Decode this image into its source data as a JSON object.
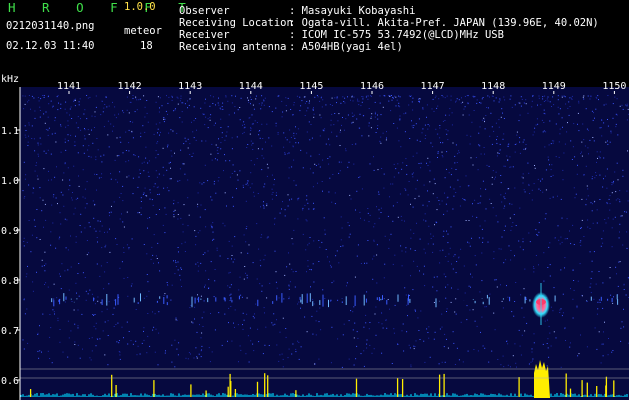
{
  "header": {
    "app_name": "H R O F F T",
    "version": "1.0.0",
    "filename": "0212031140.png",
    "datetime": "02.12.03 11:40",
    "meteor_label": "meteor",
    "meteor_count": "18",
    "info": [
      {
        "label": "Observer",
        "value": ": Masayuki Kobayashi"
      },
      {
        "label": "Receiving Location",
        "value": ": Ogata-vill. Akita-Pref. JAPAN (139.96E, 40.02N)"
      },
      {
        "label": "Receiver",
        "value": ": ICOM IC-575 53.7492(@LCD)MHz USB"
      },
      {
        "label": "Receiving antenna",
        "value": ": A504HB(yagi 4el)"
      }
    ]
  },
  "spectrogram": {
    "unit_label": "kHz",
    "y_ticks": [
      {
        "label": "1.1",
        "value": 1.1
      },
      {
        "label": "1.0",
        "value": 1.0
      },
      {
        "label": "0.9",
        "value": 0.9
      },
      {
        "label": "0.8",
        "value": 0.8
      },
      {
        "label": "0.7",
        "value": 0.7
      },
      {
        "label": "0.6",
        "value": 0.6
      }
    ],
    "x_ticks": [
      "1141",
      "1142",
      "1143",
      "1144",
      "1145",
      "1146",
      "1147",
      "1148",
      "1149",
      "1150"
    ],
    "colors": {
      "noise_background": "#0b0f6a",
      "noise_speckle": "#3b55ff",
      "meteor_core": "#ff3a6a",
      "meteor_halo": "#31e0ff",
      "level_bar": "#ffee00",
      "level_floor": "#00d8ff"
    }
  }
}
